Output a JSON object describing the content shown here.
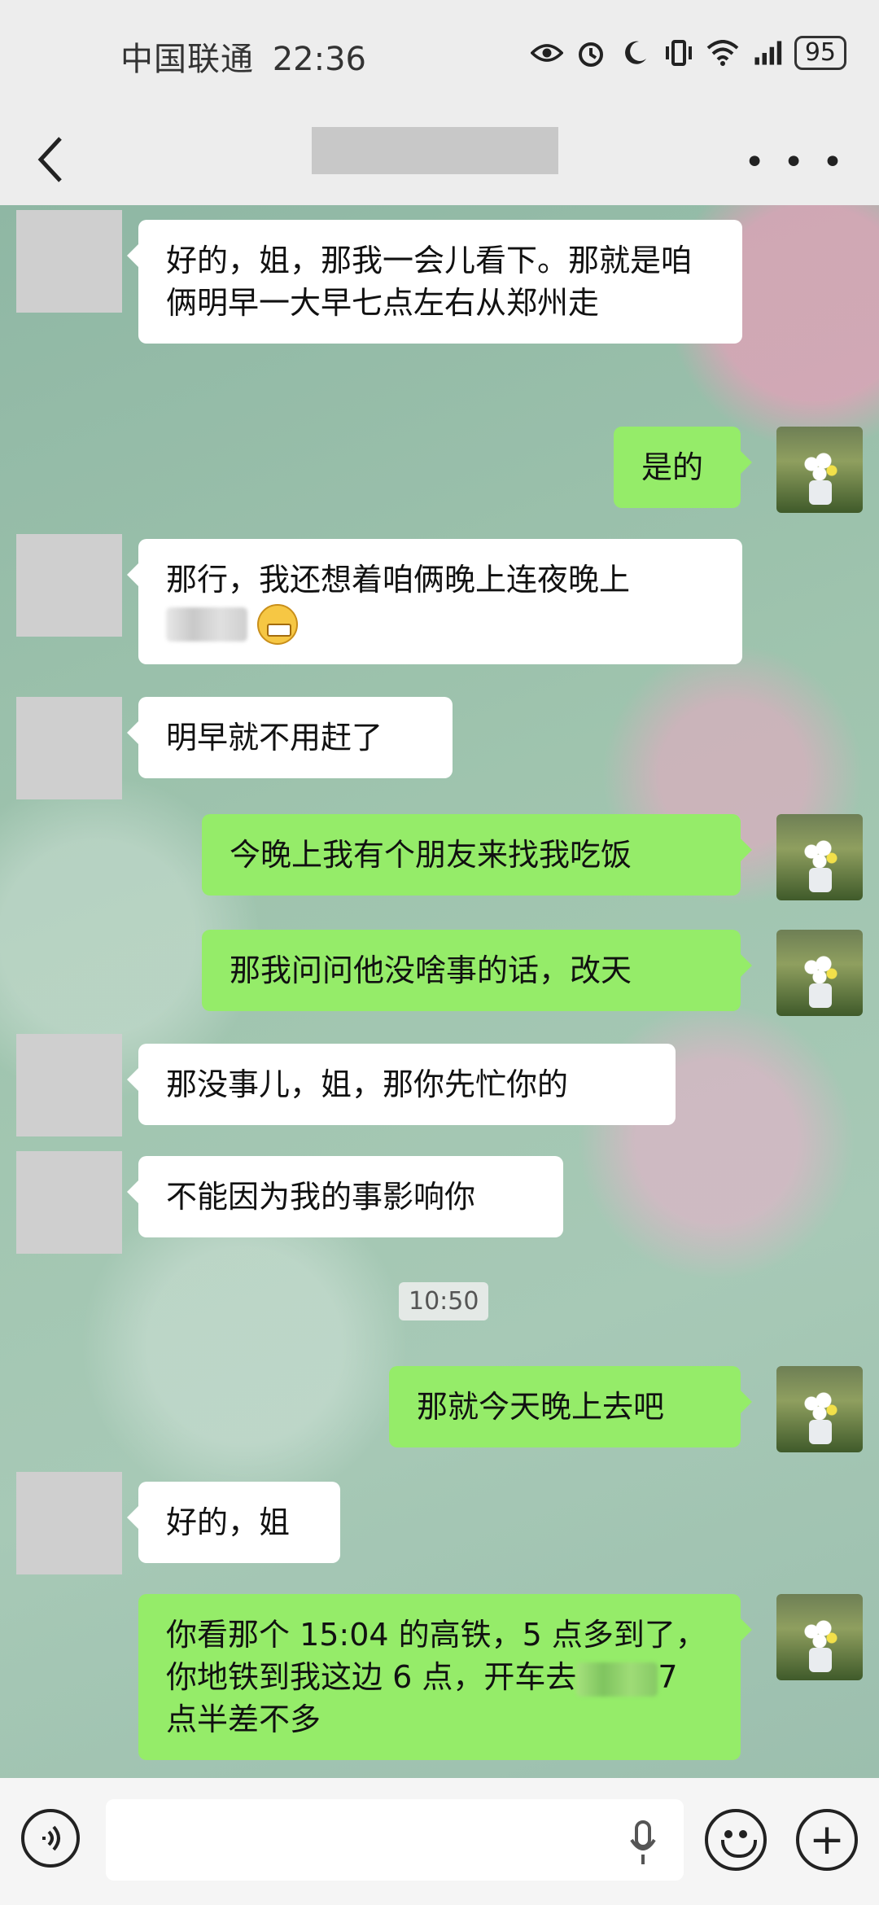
{
  "status_bar": {
    "carrier": "中国联通",
    "time": "22:36",
    "battery": "95"
  },
  "header": {
    "title": ""
  },
  "messages": [
    {
      "side": "in",
      "text": "好的，姐，那我一会儿看下。那就是咱俩明早一大早七点左右从郑州走"
    },
    {
      "side": "out",
      "text": "是的"
    },
    {
      "side": "in",
      "text": "那行，我还想着咱俩晚上连夜晚上"
    },
    {
      "side": "in",
      "text": "明早就不用赶了"
    },
    {
      "side": "out",
      "text": "今晚上我有个朋友来找我吃饭"
    },
    {
      "side": "out",
      "text": "那我问问他没啥事的话，改天"
    },
    {
      "side": "in",
      "text": "那没事儿，姐，那你先忙你的"
    },
    {
      "side": "in",
      "text": "不能因为我的事影响你"
    },
    {
      "side": "out",
      "text": "那就今天晚上去吧"
    },
    {
      "side": "in",
      "text": "好的，姐"
    },
    {
      "side": "out",
      "text": "你看那个 15:04 的高铁，5 点多到了，你地铁到我这边 6 点，开车去",
      "text_tail": "7 点半差不多"
    }
  ],
  "timestamp": "10:50",
  "input_bar": {
    "placeholder": ""
  }
}
